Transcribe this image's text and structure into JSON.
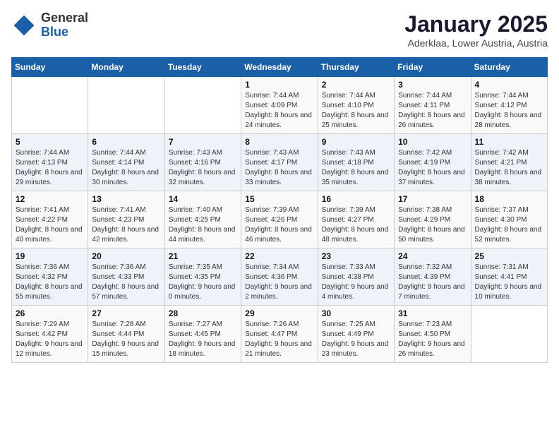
{
  "header": {
    "logo_general": "General",
    "logo_blue": "Blue",
    "month_title": "January 2025",
    "location": "Aderklaa, Lower Austria, Austria"
  },
  "weekdays": [
    "Sunday",
    "Monday",
    "Tuesday",
    "Wednesday",
    "Thursday",
    "Friday",
    "Saturday"
  ],
  "weeks": [
    [
      {
        "day": "",
        "info": ""
      },
      {
        "day": "",
        "info": ""
      },
      {
        "day": "",
        "info": ""
      },
      {
        "day": "1",
        "info": "Sunrise: 7:44 AM\nSunset: 4:09 PM\nDaylight: 8 hours and 24 minutes."
      },
      {
        "day": "2",
        "info": "Sunrise: 7:44 AM\nSunset: 4:10 PM\nDaylight: 8 hours and 25 minutes."
      },
      {
        "day": "3",
        "info": "Sunrise: 7:44 AM\nSunset: 4:11 PM\nDaylight: 8 hours and 26 minutes."
      },
      {
        "day": "4",
        "info": "Sunrise: 7:44 AM\nSunset: 4:12 PM\nDaylight: 8 hours and 28 minutes."
      }
    ],
    [
      {
        "day": "5",
        "info": "Sunrise: 7:44 AM\nSunset: 4:13 PM\nDaylight: 8 hours and 29 minutes."
      },
      {
        "day": "6",
        "info": "Sunrise: 7:44 AM\nSunset: 4:14 PM\nDaylight: 8 hours and 30 minutes."
      },
      {
        "day": "7",
        "info": "Sunrise: 7:43 AM\nSunset: 4:16 PM\nDaylight: 8 hours and 32 minutes."
      },
      {
        "day": "8",
        "info": "Sunrise: 7:43 AM\nSunset: 4:17 PM\nDaylight: 8 hours and 33 minutes."
      },
      {
        "day": "9",
        "info": "Sunrise: 7:43 AM\nSunset: 4:18 PM\nDaylight: 8 hours and 35 minutes."
      },
      {
        "day": "10",
        "info": "Sunrise: 7:42 AM\nSunset: 4:19 PM\nDaylight: 8 hours and 37 minutes."
      },
      {
        "day": "11",
        "info": "Sunrise: 7:42 AM\nSunset: 4:21 PM\nDaylight: 8 hours and 38 minutes."
      }
    ],
    [
      {
        "day": "12",
        "info": "Sunrise: 7:41 AM\nSunset: 4:22 PM\nDaylight: 8 hours and 40 minutes."
      },
      {
        "day": "13",
        "info": "Sunrise: 7:41 AM\nSunset: 4:23 PM\nDaylight: 8 hours and 42 minutes."
      },
      {
        "day": "14",
        "info": "Sunrise: 7:40 AM\nSunset: 4:25 PM\nDaylight: 8 hours and 44 minutes."
      },
      {
        "day": "15",
        "info": "Sunrise: 7:39 AM\nSunset: 4:26 PM\nDaylight: 8 hours and 46 minutes."
      },
      {
        "day": "16",
        "info": "Sunrise: 7:39 AM\nSunset: 4:27 PM\nDaylight: 8 hours and 48 minutes."
      },
      {
        "day": "17",
        "info": "Sunrise: 7:38 AM\nSunset: 4:29 PM\nDaylight: 8 hours and 50 minutes."
      },
      {
        "day": "18",
        "info": "Sunrise: 7:37 AM\nSunset: 4:30 PM\nDaylight: 8 hours and 52 minutes."
      }
    ],
    [
      {
        "day": "19",
        "info": "Sunrise: 7:36 AM\nSunset: 4:32 PM\nDaylight: 8 hours and 55 minutes."
      },
      {
        "day": "20",
        "info": "Sunrise: 7:36 AM\nSunset: 4:33 PM\nDaylight: 8 hours and 57 minutes."
      },
      {
        "day": "21",
        "info": "Sunrise: 7:35 AM\nSunset: 4:35 PM\nDaylight: 9 hours and 0 minutes."
      },
      {
        "day": "22",
        "info": "Sunrise: 7:34 AM\nSunset: 4:36 PM\nDaylight: 9 hours and 2 minutes."
      },
      {
        "day": "23",
        "info": "Sunrise: 7:33 AM\nSunset: 4:38 PM\nDaylight: 9 hours and 4 minutes."
      },
      {
        "day": "24",
        "info": "Sunrise: 7:32 AM\nSunset: 4:39 PM\nDaylight: 9 hours and 7 minutes."
      },
      {
        "day": "25",
        "info": "Sunrise: 7:31 AM\nSunset: 4:41 PM\nDaylight: 9 hours and 10 minutes."
      }
    ],
    [
      {
        "day": "26",
        "info": "Sunrise: 7:29 AM\nSunset: 4:42 PM\nDaylight: 9 hours and 12 minutes."
      },
      {
        "day": "27",
        "info": "Sunrise: 7:28 AM\nSunset: 4:44 PM\nDaylight: 9 hours and 15 minutes."
      },
      {
        "day": "28",
        "info": "Sunrise: 7:27 AM\nSunset: 4:45 PM\nDaylight: 9 hours and 18 minutes."
      },
      {
        "day": "29",
        "info": "Sunrise: 7:26 AM\nSunset: 4:47 PM\nDaylight: 9 hours and 21 minutes."
      },
      {
        "day": "30",
        "info": "Sunrise: 7:25 AM\nSunset: 4:49 PM\nDaylight: 9 hours and 23 minutes."
      },
      {
        "day": "31",
        "info": "Sunrise: 7:23 AM\nSunset: 4:50 PM\nDaylight: 9 hours and 26 minutes."
      },
      {
        "day": "",
        "info": ""
      }
    ]
  ]
}
